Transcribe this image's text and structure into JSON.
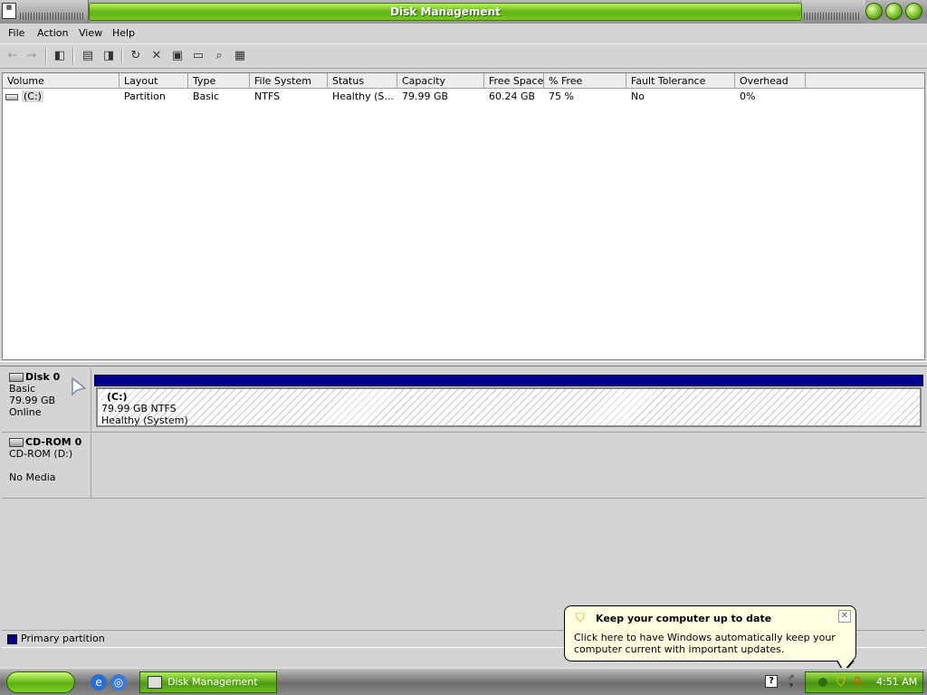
{
  "window": {
    "title": "Disk Management"
  },
  "menu": [
    "File",
    "Action",
    "View",
    "Help"
  ],
  "toolbar_icons": [
    "back-icon",
    "forward-icon",
    "show-hide-console-tree-icon",
    "properties-icon",
    "help-icon",
    "refresh-icon",
    "delete-icon",
    "settings-icon",
    "open-folder-icon",
    "search-icon",
    "configure-icon"
  ],
  "columns": [
    "Volume",
    "Layout",
    "Type",
    "File System",
    "Status",
    "Capacity",
    "Free Space",
    "% Free",
    "Fault Tolerance",
    "Overhead"
  ],
  "volumes": [
    {
      "volume": "(C:)",
      "layout": "Partition",
      "type": "Basic",
      "file_system": "NTFS",
      "status": "Healthy (S...",
      "capacity": "79.99 GB",
      "free_space": "60.24 GB",
      "pct_free": "75 %",
      "fault_tolerance": "No",
      "overhead": "0%"
    }
  ],
  "disks": [
    {
      "name": "Disk 0",
      "type": "Basic",
      "size": "79.99 GB",
      "state": "Online",
      "partition": {
        "name": "(C:)",
        "detail": "79.99 GB NTFS",
        "status": "Healthy (System)"
      }
    },
    {
      "name": "CD-ROM 0",
      "type": "CD-ROM (D:)",
      "state": "No Media"
    }
  ],
  "legend": {
    "label": "Primary partition",
    "color": "#00008b"
  },
  "taskbar": {
    "task_label": "Disk Management",
    "clock": "4:51 AM"
  },
  "balloon": {
    "title": "Keep your computer up to date",
    "text": "Click here to have Windows automatically keep your computer current with important updates."
  },
  "colors": {
    "title_green": "#5fb012",
    "primary_partition": "#00008b",
    "balloon_bg": "#ffffe1"
  }
}
